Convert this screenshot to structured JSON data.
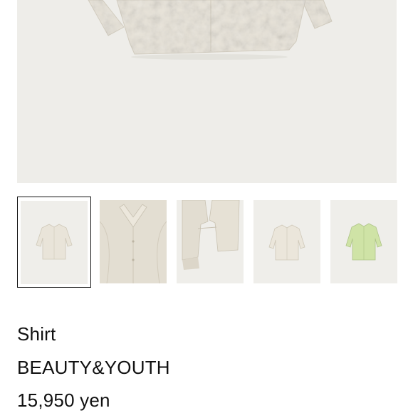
{
  "product": {
    "name": "Shirt",
    "brand": "BEAUTY&YOUTH",
    "price": "15,950 yen"
  },
  "gallery": {
    "main_image": "cream-textured-shirt-front",
    "selected_index": 0,
    "thumbnails": [
      {
        "name": "thumb-cream-shirt-front"
      },
      {
        "name": "thumb-cream-shirt-collar-detail"
      },
      {
        "name": "thumb-cream-shirt-hem-detail"
      },
      {
        "name": "thumb-cream-shirt-front-small"
      },
      {
        "name": "thumb-green-shirt-front"
      }
    ]
  },
  "colors": {
    "background": "#ffffff",
    "image_background": "#eeede9",
    "cream_fabric": "#e6e1d6",
    "green_fabric": "#cfe3a6",
    "text": "#111111",
    "selected_border": "#111111"
  }
}
